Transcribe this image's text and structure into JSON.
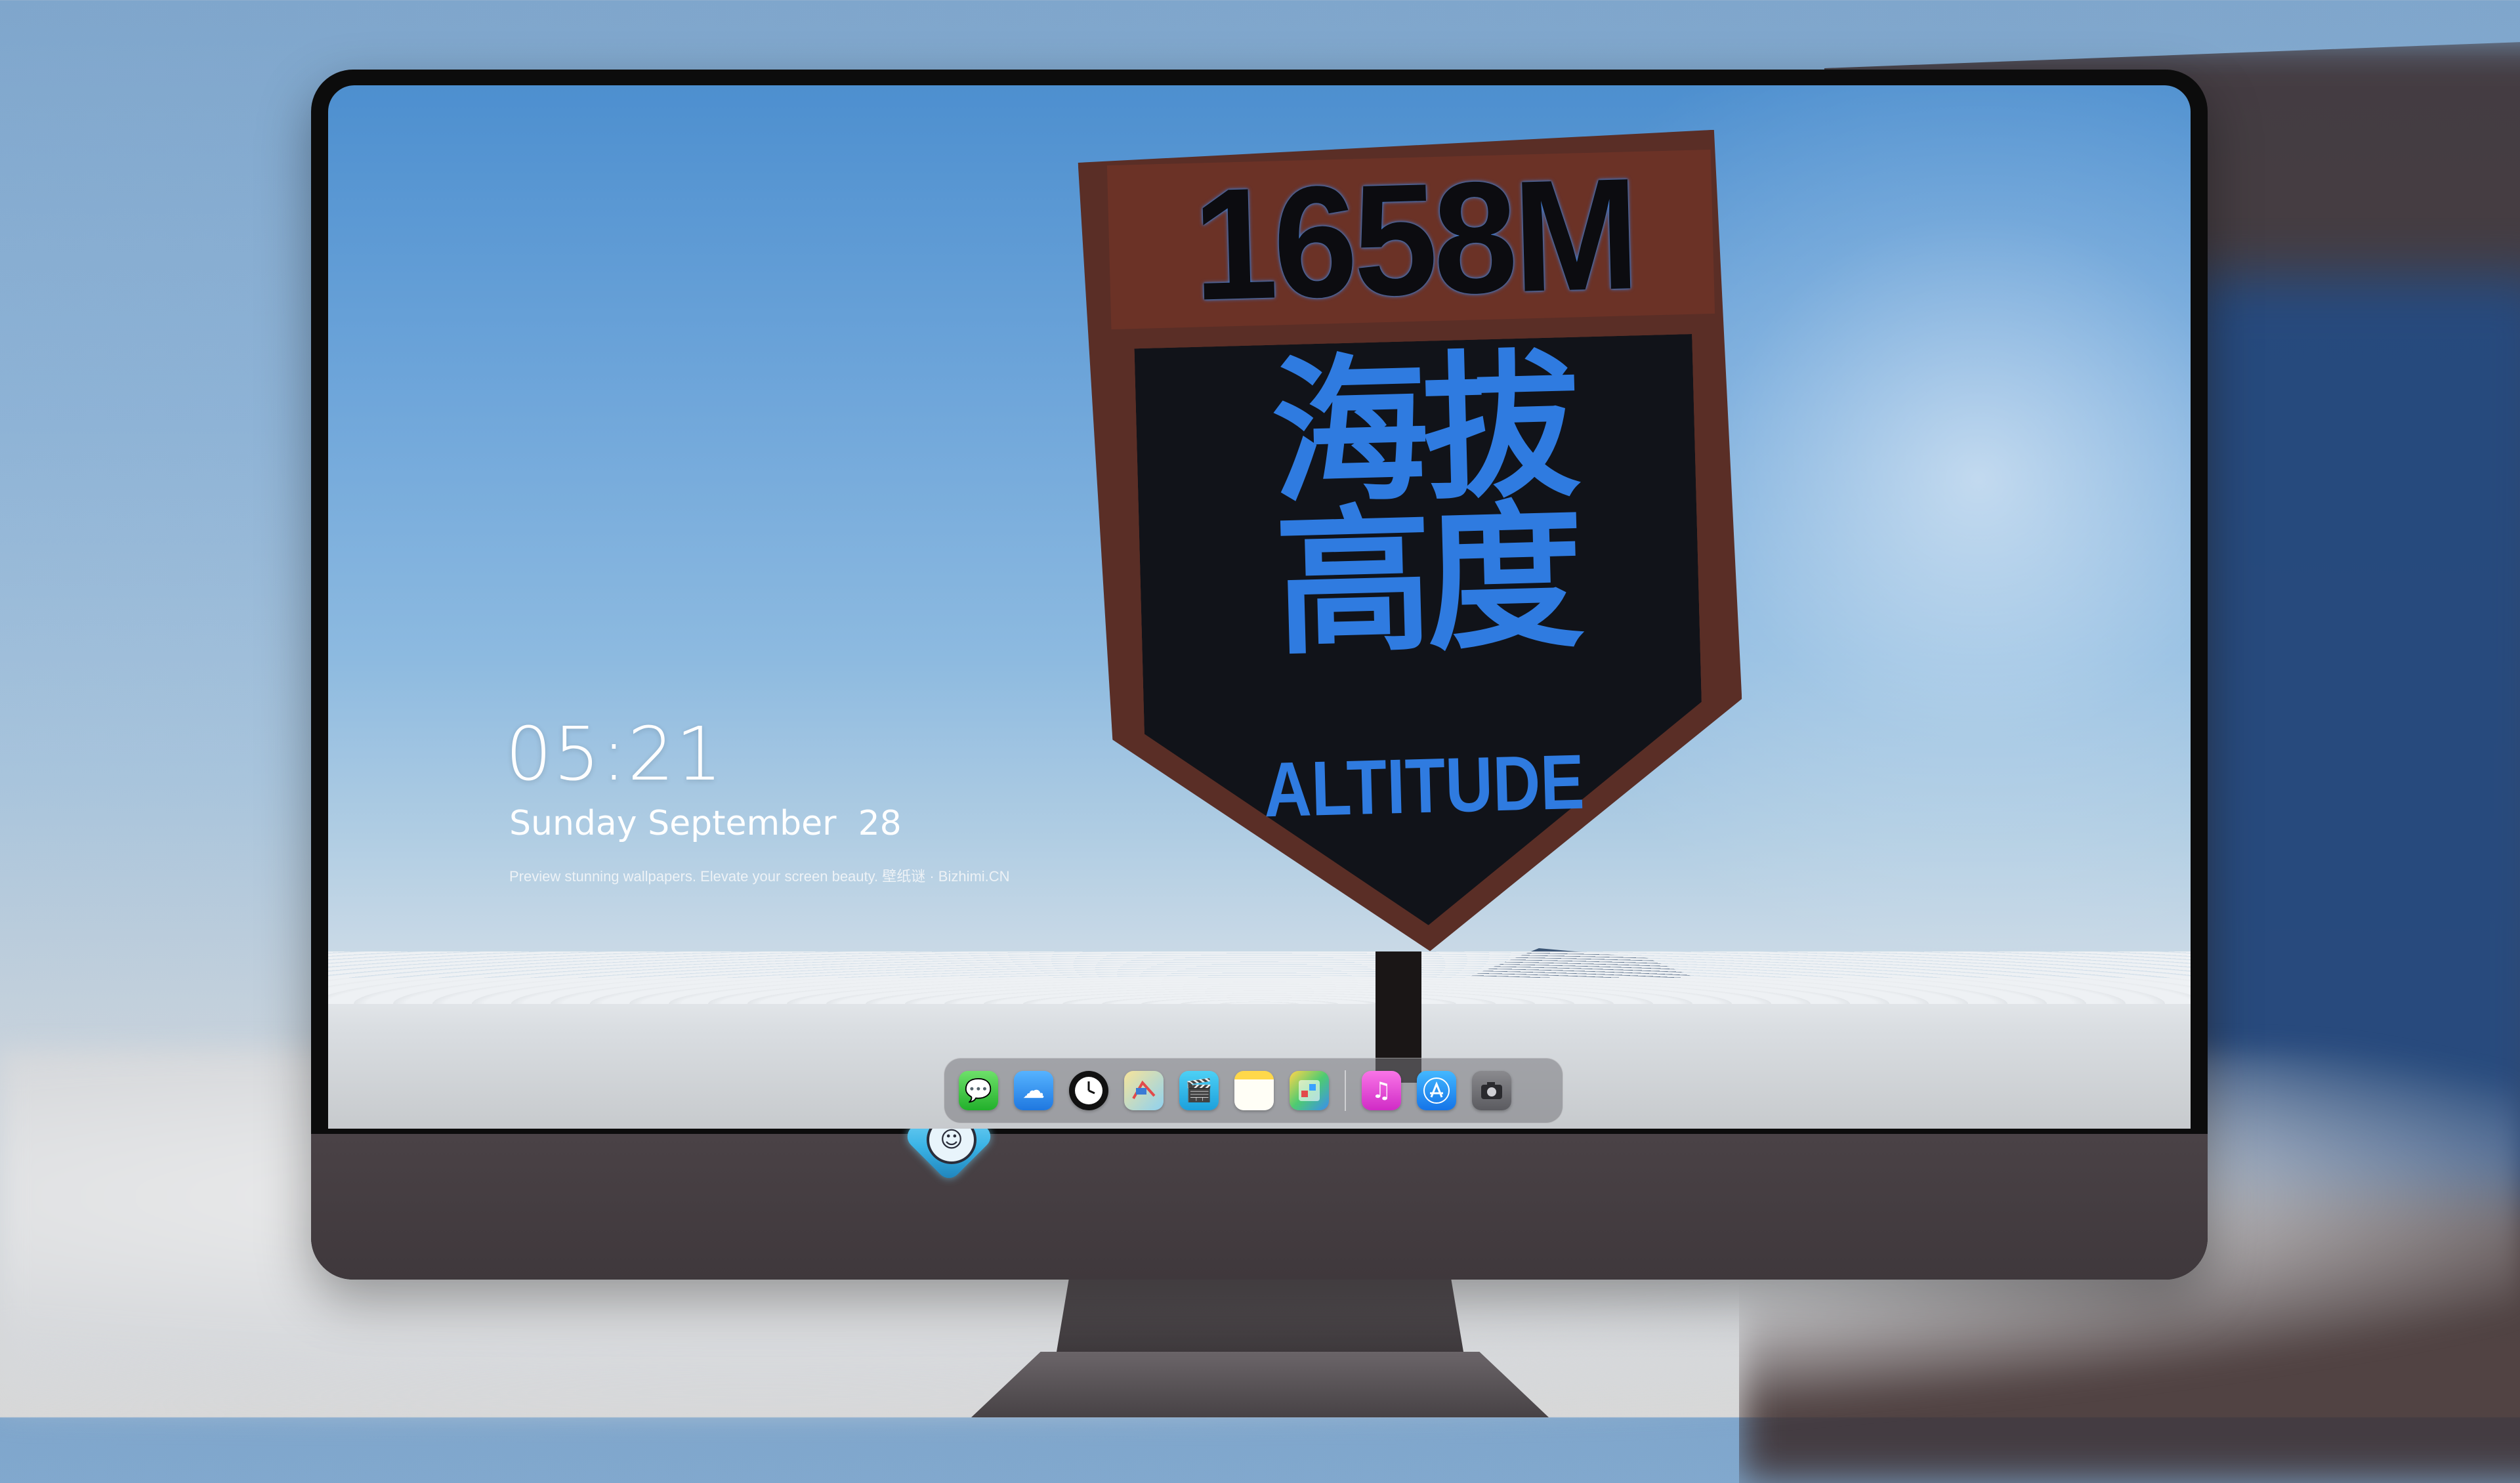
{
  "lockscreen": {
    "time": "05:21",
    "date": "Sunday September  28",
    "tagline": "Preview stunning wallpapers. Elevate your screen beauty. 壁纸谜 · Bizhimi.CN"
  },
  "wallpaper": {
    "sign_altitude": "1658M",
    "sign_chinese": "海拔\n高度",
    "sign_english": "ALTITUDE"
  },
  "dock": {
    "apps": [
      {
        "name": "Messages",
        "icon": "message-icon"
      },
      {
        "name": "Weather",
        "icon": "weather-icon"
      },
      {
        "name": "Clock",
        "icon": "clock-icon"
      },
      {
        "name": "Maps",
        "icon": "maps-icon"
      },
      {
        "name": "Clips",
        "icon": "clapper-icon"
      },
      {
        "name": "Notes",
        "icon": "notes-icon"
      },
      {
        "name": "Photos",
        "icon": "photos-icon"
      },
      {
        "name": "Music",
        "icon": "music-icon"
      },
      {
        "name": "App Store",
        "icon": "app-store-icon"
      },
      {
        "name": "Camera",
        "icon": "camera-icon"
      }
    ]
  },
  "colors": {
    "sign_blue": "#2f7be0",
    "sign_brown": "#5a2e26",
    "monitor_chin": "#4a4246"
  }
}
